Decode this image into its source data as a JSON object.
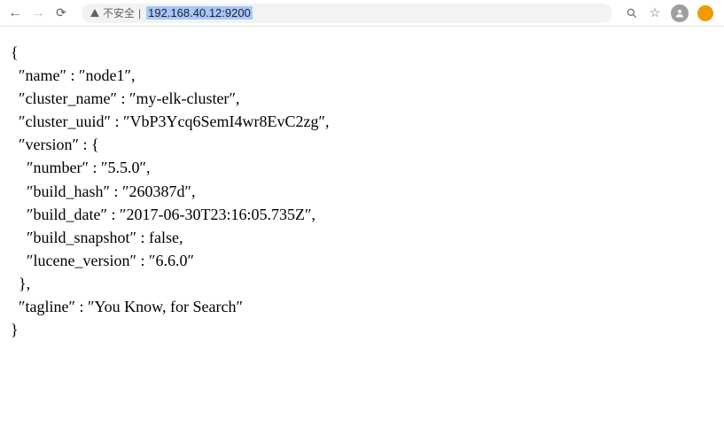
{
  "addressbar": {
    "security_label": "不安全",
    "separator": "|",
    "url": "192.168.40.12:9200"
  },
  "response": {
    "name_key": "name",
    "name_val": "node1",
    "cluster_name_key": "cluster_name",
    "cluster_name_val": "my-elk-cluster",
    "cluster_uuid_key": "cluster_uuid",
    "cluster_uuid_val": "VbP3Ycq6SemI4wr8EvC2zg",
    "version_key": "version",
    "number_key": "number",
    "number_val": "5.5.0",
    "build_hash_key": "build_hash",
    "build_hash_val": "260387d",
    "build_date_key": "build_date",
    "build_date_val": "2017-06-30T23:16:05.735Z",
    "build_snapshot_key": "build_snapshot",
    "build_snapshot_val": "false",
    "lucene_version_key": "lucene_version",
    "lucene_version_val": "6.6.0",
    "tagline_key": "tagline",
    "tagline_val": "You Know, for Search"
  }
}
